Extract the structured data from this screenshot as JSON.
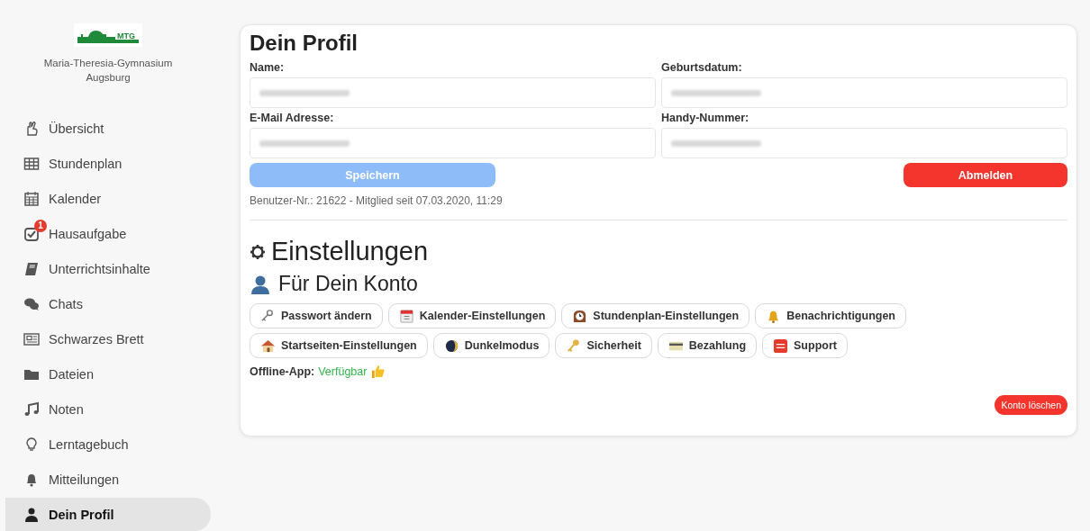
{
  "sidebar": {
    "logo_text": "MTG",
    "school": "Maria-Theresia-Gymnasium Augsburg",
    "items": [
      {
        "label": "Übersicht",
        "selected": false
      },
      {
        "label": "Stundenplan",
        "selected": false
      },
      {
        "label": "Kalender",
        "selected": false
      },
      {
        "label": "Hausaufgabe",
        "selected": false,
        "badge": "1"
      },
      {
        "label": "Unterrichtsinhalte",
        "selected": false
      },
      {
        "label": "Chats",
        "selected": false
      },
      {
        "label": "Schwarzes Brett",
        "selected": false
      },
      {
        "label": "Dateien",
        "selected": false
      },
      {
        "label": "Noten",
        "selected": false
      },
      {
        "label": "Lerntagebuch",
        "selected": false
      },
      {
        "label": "Mitteilungen",
        "selected": false
      },
      {
        "label": "Dein Profil",
        "selected": true
      }
    ]
  },
  "profile": {
    "title": "Dein Profil",
    "fields": [
      {
        "label": "Name:"
      },
      {
        "label": "Geburtsdatum:"
      },
      {
        "label": "E-Mail Adresse:"
      },
      {
        "label": "Handy-Nummer:"
      }
    ],
    "save_button": {
      "label": "Speichern",
      "disabled": true
    },
    "logout_button": "Abmelden",
    "info": "Benutzer-Nr.: 21622 - Mitglied seit 07.03.2020, 11:29"
  },
  "settings": {
    "title": "Einstellungen",
    "subtitle": "Für Dein Konto",
    "buttons": [
      {
        "label": "Passwort ändern"
      },
      {
        "label": "Kalender-Einstellungen"
      },
      {
        "label": "Stundenplan-Einstellungen"
      },
      {
        "label": "Benachrichtigungen"
      },
      {
        "label": "Startseiten-Einstellungen"
      },
      {
        "label": "Dunkelmodus"
      },
      {
        "label": "Sicherheit"
      },
      {
        "label": "Bezahlung"
      },
      {
        "label": "Support"
      }
    ],
    "offline_label": "Offline-App:",
    "offline_status": "Verfügbar",
    "delete_button": "Konto löschen"
  }
}
